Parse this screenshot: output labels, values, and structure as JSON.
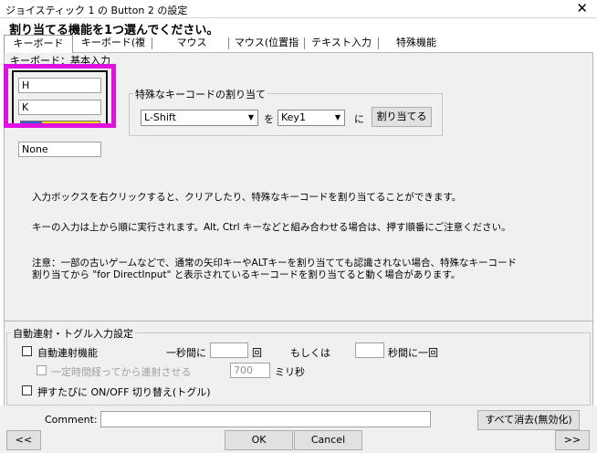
{
  "window": {
    "title": "ジョイスティック 1 の Button 2 の設定",
    "close_glyph": "✕"
  },
  "instruction": "割り当てる機能を1つ選んでください。",
  "tabs": [
    {
      "label": "キーボード",
      "selected": true
    },
    {
      "label": "キーボード(複"
    },
    {
      "label": "マウス"
    },
    {
      "label": "マウス(位置指"
    },
    {
      "label": "テキスト入力"
    },
    {
      "label": "特殊機能"
    }
  ],
  "keyboard_panel": {
    "group_label": "キーボード：基本入力",
    "key_inputs": [
      "H",
      "K",
      "None"
    ],
    "progress": {
      "blue_fraction": 0.27,
      "yellow_fraction": 0.73
    },
    "special_key": {
      "legend": "特殊なキーコードの割り当て",
      "from_value": "L-Shift",
      "wo_label": "を",
      "to_value": "Key1",
      "ni_label": "に",
      "assign_label": "割り当てる"
    },
    "notes": [
      "入力ボックスを右クリックすると、クリアしたり、特殊なキーコードを割り当てることができます。",
      "キーの入力は上から順に実行されます。Alt, Ctrl キーなどと組み合わせる場合は、押す順番にご注意ください。",
      "注意：一部の古いゲームなどで、通常の矢印キーやALTキーを割り当てても認識されない場合、特殊なキーコード",
      "割り当てから \"for DirectInput\" と表示されているキーコードを割り当てると動く場合があります。"
    ]
  },
  "auto_fire": {
    "legend": "自動連射・トグル入力設定",
    "enable_label": "自動連射機能",
    "per_second_label": "一秒間に",
    "times_suffix": "回",
    "or_label": "もしくは",
    "seconds_per_once": "秒間に一回",
    "delay_label": "一定時間経ってから連射させる",
    "delay_value": "700",
    "ms_label": "ミリ秒",
    "toggle_label": "押すたびに ON/OFF 切り替え(トグル)"
  },
  "footer": {
    "comment_label": "Comment:",
    "comment_value": "",
    "clear_all_label": "すべて消去(無効化)",
    "prev_label": "<<",
    "ok_label": "OK",
    "cancel_label": "Cancel",
    "next_label": ">>"
  }
}
